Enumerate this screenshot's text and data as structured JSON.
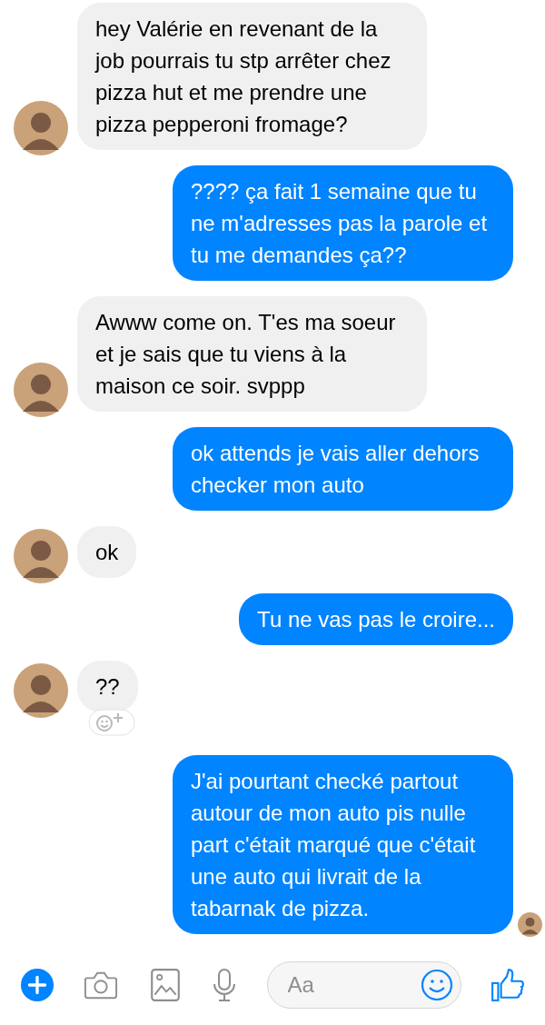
{
  "messages": [
    {
      "kind": "incoming",
      "text": "hey Valérie en revenant de la job pourrais tu stp arrêter chez pizza hut et me prendre une pizza pepperoni fromage?"
    },
    {
      "kind": "outgoing",
      "text": "???? ça fait 1 semaine que tu ne m'adresses pas la parole et tu me demandes ça??"
    },
    {
      "kind": "incoming",
      "text": "Awww come on. T'es ma soeur et je sais que tu viens à la maison ce soir. svppp"
    },
    {
      "kind": "outgoing",
      "text": "ok attends je vais aller dehors checker mon auto"
    },
    {
      "kind": "incoming",
      "text": "ok"
    },
    {
      "kind": "outgoing",
      "text": "Tu ne vas pas le croire..."
    },
    {
      "kind": "incoming",
      "text": "??",
      "reaction_button": true
    },
    {
      "kind": "outgoing",
      "text": "J'ai pourtant checké partout autour de mon auto pis nulle part c'était marqué que c'était une auto qui livrait de la tabarnak de pizza.",
      "seen": true
    }
  ],
  "composer": {
    "placeholder": "Aa"
  }
}
